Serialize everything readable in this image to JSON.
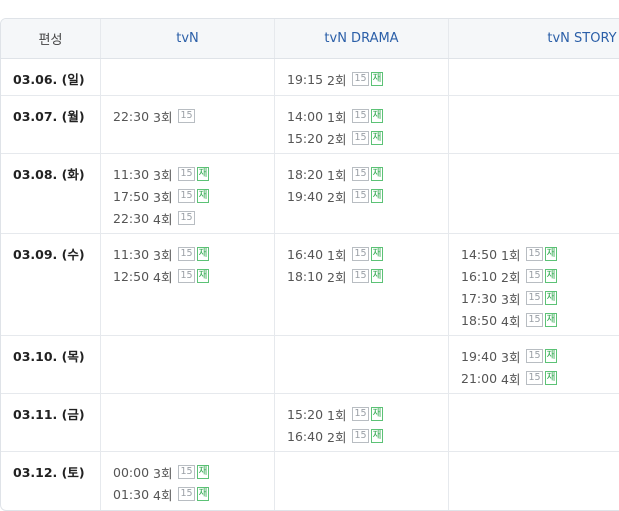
{
  "columns": {
    "schedule": "편성",
    "tvn": "tvN",
    "drama": "tvN DRAMA",
    "story": "tvN STORY"
  },
  "badges": {
    "age": "15",
    "rerun": "재"
  },
  "rows": [
    {
      "date": "03.06. (일)",
      "tvn": [],
      "drama": [
        {
          "time": "19:15",
          "ep": "2회",
          "rerun": true
        }
      ],
      "story": []
    },
    {
      "date": "03.07. (월)",
      "tvn": [
        {
          "time": "22:30",
          "ep": "3회",
          "rerun": false
        }
      ],
      "drama": [
        {
          "time": "14:00",
          "ep": "1회",
          "rerun": true
        },
        {
          "time": "15:20",
          "ep": "2회",
          "rerun": true
        }
      ],
      "story": []
    },
    {
      "date": "03.08. (화)",
      "tvn": [
        {
          "time": "11:30",
          "ep": "3회",
          "rerun": true
        },
        {
          "time": "17:50",
          "ep": "3회",
          "rerun": true
        },
        {
          "time": "22:30",
          "ep": "4회",
          "rerun": false
        }
      ],
      "drama": [
        {
          "time": "18:20",
          "ep": "1회",
          "rerun": true
        },
        {
          "time": "19:40",
          "ep": "2회",
          "rerun": true
        }
      ],
      "story": []
    },
    {
      "date": "03.09. (수)",
      "tvn": [
        {
          "time": "11:30",
          "ep": "3회",
          "rerun": true
        },
        {
          "time": "12:50",
          "ep": "4회",
          "rerun": true
        }
      ],
      "drama": [
        {
          "time": "16:40",
          "ep": "1회",
          "rerun": true
        },
        {
          "time": "18:10",
          "ep": "2회",
          "rerun": true
        }
      ],
      "story": [
        {
          "time": "14:50",
          "ep": "1회",
          "rerun": true
        },
        {
          "time": "16:10",
          "ep": "2회",
          "rerun": true
        },
        {
          "time": "17:30",
          "ep": "3회",
          "rerun": true
        },
        {
          "time": "18:50",
          "ep": "4회",
          "rerun": true
        }
      ]
    },
    {
      "date": "03.10. (목)",
      "tvn": [],
      "drama": [],
      "story": [
        {
          "time": "19:40",
          "ep": "3회",
          "rerun": true
        },
        {
          "time": "21:00",
          "ep": "4회",
          "rerun": true
        }
      ]
    },
    {
      "date": "03.11. (금)",
      "tvn": [],
      "drama": [
        {
          "time": "15:20",
          "ep": "1회",
          "rerun": true
        },
        {
          "time": "16:40",
          "ep": "2회",
          "rerun": true
        }
      ],
      "story": []
    },
    {
      "date": "03.12. (토)",
      "tvn": [
        {
          "time": "00:00",
          "ep": "3회",
          "rerun": true
        },
        {
          "time": "01:30",
          "ep": "4회",
          "rerun": true
        }
      ],
      "drama": [],
      "story": []
    }
  ]
}
